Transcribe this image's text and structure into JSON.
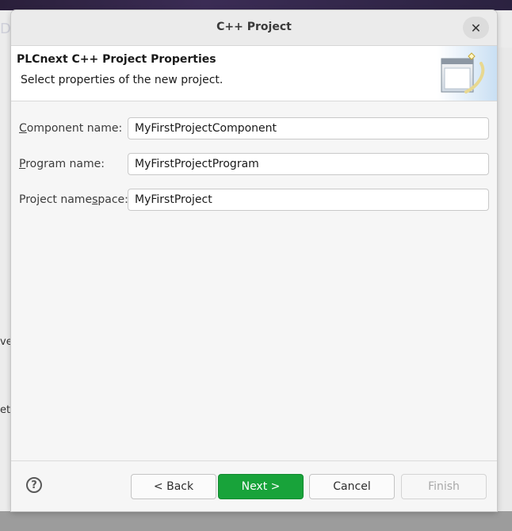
{
  "window": {
    "title": "C++ Project"
  },
  "behind": {
    "top_fragment": "De",
    "mid_fragment": "ve",
    "low_fragment": "etp"
  },
  "header": {
    "title": "PLCnext C++ Project Properties",
    "description": "Select properties of the new project."
  },
  "form": {
    "component_label_mnemonic": "C",
    "component_label_rest": "omponent name:",
    "component_value": "MyFirstProjectComponent",
    "program_label_mnemonic": "P",
    "program_label_rest": "rogram name:",
    "program_value": "MyFirstProjectProgram",
    "namespace_label_pre": "Project name",
    "namespace_label_mnemonic": "s",
    "namespace_label_post": "pace:",
    "namespace_value": "MyFirstProject"
  },
  "buttons": {
    "help_glyph": "?",
    "back": "< Back",
    "next": "Next >",
    "cancel": "Cancel",
    "finish": "Finish"
  },
  "colors": {
    "primary": "#18a33a"
  },
  "icons": {
    "close": "close-icon",
    "help": "help-icon",
    "banner": "wizard-banner-icon"
  }
}
